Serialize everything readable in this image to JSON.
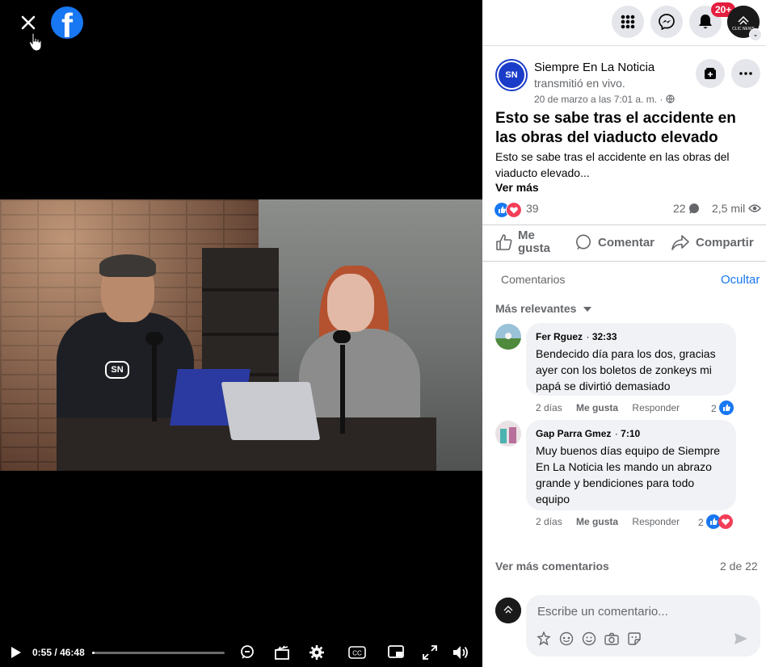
{
  "player": {
    "current_time": "0:55",
    "separator": "/",
    "duration": "46:48",
    "progress_fraction": 0.0196
  },
  "topbar": {
    "notifications_badge": "20+",
    "avatar_text": "CLIC NEWS"
  },
  "post": {
    "page_name": "Siempre En La Noticia",
    "page_avatar_text": "SN",
    "action_text": "transmitió en vivo.",
    "date": "20 de marzo a las 7:01 a. m. ·",
    "title": "Esto se sabe tras el accidente en las obras del viaducto elevado",
    "body": "Esto se sabe tras el accidente en las obras del viaducto elevado...",
    "see_more": "Ver más",
    "reactions_count": "39",
    "comments_count": "22",
    "views_count": "2,5 mil"
  },
  "actions": {
    "like": "Me gusta",
    "comment": "Comentar",
    "share": "Compartir"
  },
  "comments_section": {
    "header": "Comentarios",
    "hide": "Ocultar",
    "sort": "Más relevantes",
    "items": [
      {
        "author": "Fer Rguez",
        "time": "32:33",
        "text": "Bendecido día para los dos, gracias ayer con los boletos de zonkeys mi papá se divirtió demasiado",
        "age": "2 días",
        "like": "Me gusta",
        "reply": "Responder",
        "reaction_count": "2"
      },
      {
        "author": "Gap Parra Gmez",
        "time": "7:10",
        "text": "Muy buenos días equipo de Siempre En La Noticia les mando un abrazo grande y bendiciones para todo equipo",
        "age": "2 días",
        "like": "Me gusta",
        "reply": "Responder",
        "reaction_count": "2"
      }
    ],
    "more_comments": "Ver más comentarios",
    "pagination": "2 de 22",
    "composer_placeholder": "Escribe un comentario..."
  },
  "colors": {
    "brand": "#1877f2",
    "badge": "#e41e3f",
    "muted": "#65676b",
    "bubble": "#f0f2f5"
  },
  "icons": [
    "close-icon",
    "facebook-logo",
    "menu-grid-icon",
    "messenger-icon",
    "bell-icon",
    "save-icon",
    "more-icon",
    "globe-icon",
    "like-icon",
    "love-icon",
    "comment-icon",
    "eye-icon",
    "share-icon",
    "play-icon",
    "settings-icon",
    "cc-icon",
    "volume-icon",
    "fullscreen-icon",
    "send-icon"
  ]
}
